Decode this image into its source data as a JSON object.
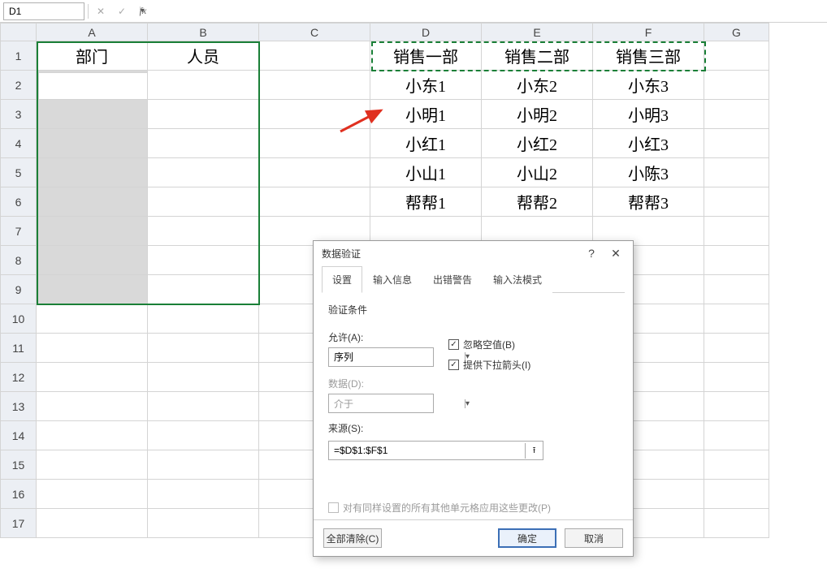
{
  "namebox": {
    "value": "D1"
  },
  "fx": {
    "x_icon": "✕",
    "check_icon": "✓",
    "fx_label": "fx"
  },
  "columns": [
    "A",
    "B",
    "C",
    "D",
    "E",
    "F",
    "G"
  ],
  "rows": [
    "1",
    "2",
    "3",
    "4",
    "5",
    "6",
    "7",
    "8",
    "9",
    "10",
    "11",
    "12",
    "13",
    "14",
    "15",
    "16",
    "17"
  ],
  "cells": {
    "A1": "部门",
    "B1": "人员",
    "D1": "销售一部",
    "E1": "销售二部",
    "F1": "销售三部",
    "D2": "小东1",
    "E2": "小东2",
    "F2": "小东3",
    "D3": "小明1",
    "E3": "小明2",
    "F3": "小明3",
    "D4": "小红1",
    "E4": "小红2",
    "F4": "小红3",
    "D5": "小山1",
    "E5": "小山2",
    "F5": "小陈3",
    "D6": "帮帮1",
    "E6": "帮帮2",
    "F6": "帮帮3"
  },
  "dialog": {
    "title": "数据验证",
    "help": "?",
    "close": "✕",
    "tabs": {
      "settings": "设置",
      "input": "输入信息",
      "error": "出错警告",
      "ime": "输入法模式"
    },
    "group": "验证条件",
    "allow_label": "允许(A):",
    "allow_value": "序列",
    "ignore_blank": "忽略空值(B)",
    "dropdown_chk": "提供下拉箭头(I)",
    "data_label": "数据(D):",
    "data_value": "介于",
    "source_label": "来源(S):",
    "source_value": "=$D$1:$F$1",
    "apply_all": "对有同样设置的所有其他单元格应用这些更改(P)",
    "clear": "全部清除(C)",
    "ok": "确定",
    "cancel": "取消"
  }
}
